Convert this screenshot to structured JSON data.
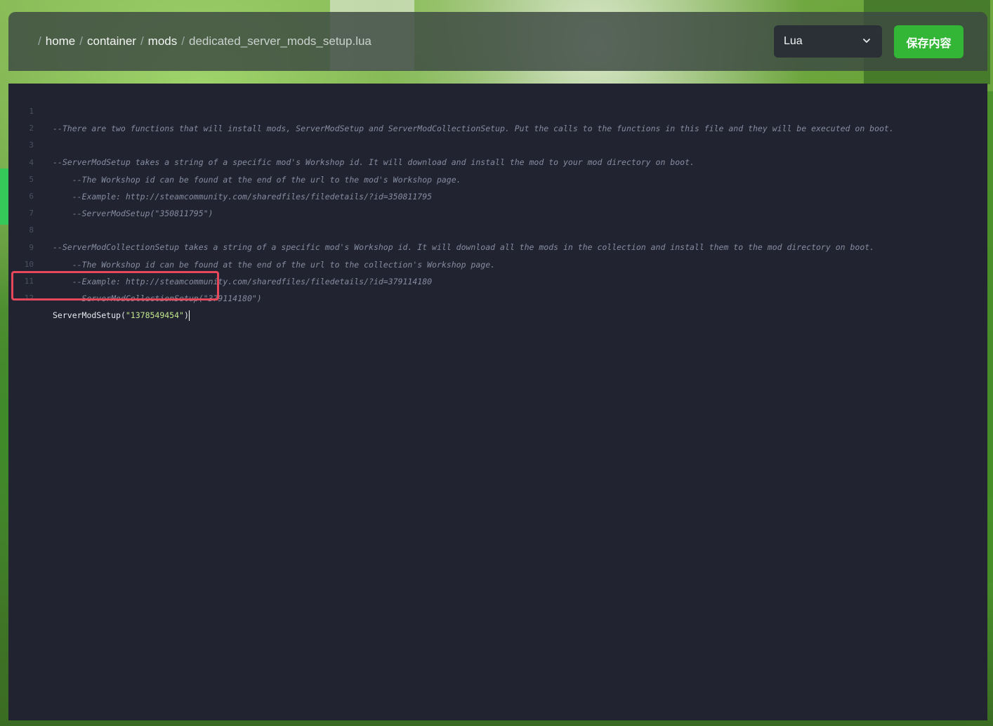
{
  "breadcrumb": {
    "items": [
      "home",
      "container",
      "mods",
      "dedicated_server_mods_setup.lua"
    ],
    "separator": "/"
  },
  "toolbar": {
    "language_selected": "Lua",
    "save_label": "保存内容"
  },
  "editor": {
    "lines": [
      {
        "num": "1",
        "text": "--There are two functions that will install mods, ServerModSetup and ServerModCollectionSetup. Put the calls to the functions in this file and they will be executed on boot."
      },
      {
        "num": "2",
        "text": ""
      },
      {
        "num": "3",
        "text": "--ServerModSetup takes a string of a specific mod's Workshop id. It will download and install the mod to your mod directory on boot."
      },
      {
        "num": "4",
        "text": "    --The Workshop id can be found at the end of the url to the mod's Workshop page."
      },
      {
        "num": "5",
        "text": "    --Example: http://steamcommunity.com/sharedfiles/filedetails/?id=350811795"
      },
      {
        "num": "6",
        "text": "    --ServerModSetup(\"350811795\")"
      },
      {
        "num": "7",
        "text": ""
      },
      {
        "num": "8",
        "text": "--ServerModCollectionSetup takes a string of a specific mod's Workshop id. It will download all the mods in the collection and install them to the mod directory on boot."
      },
      {
        "num": "9",
        "text": "    --The Workshop id can be found at the end of the url to the collection's Workshop page."
      },
      {
        "num": "10",
        "text": "    --Example: http://steamcommunity.com/sharedfiles/filedetails/?id=379114180"
      },
      {
        "num": "11",
        "text": "    --ServerModCollectionSetup(\"379114180\")"
      },
      {
        "num": "12",
        "fn": "ServerModSetup",
        "open": "(",
        "str": "\"1378549454\"",
        "close": ")"
      }
    ]
  },
  "colors": {
    "save_button": "#33b536",
    "editor_bg": "#212330",
    "highlight_box": "#e5485a",
    "string": "#c2e88d"
  }
}
